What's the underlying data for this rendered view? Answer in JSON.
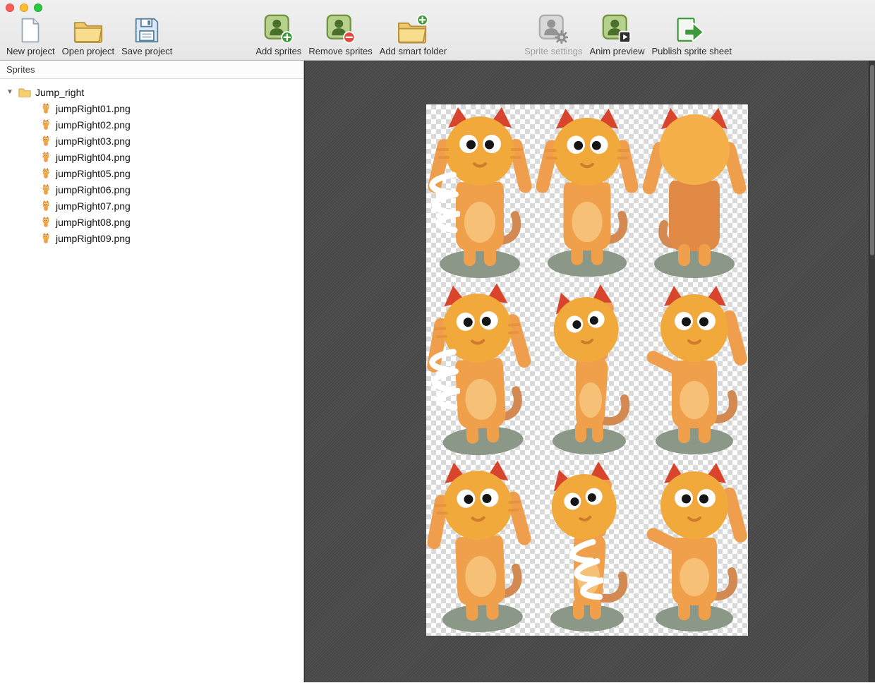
{
  "window": {
    "traffic_lights": {
      "close": "#ff5f57",
      "minimize": "#febc2e",
      "zoom": "#28c840"
    }
  },
  "toolbar": {
    "items": [
      {
        "label": "New project",
        "icon": "new-project-icon",
        "enabled": true
      },
      {
        "label": "Open project",
        "icon": "open-project-icon",
        "enabled": true
      },
      {
        "label": "Save project",
        "icon": "save-project-icon",
        "enabled": true
      },
      {
        "label": "Add sprites",
        "icon": "add-sprites-icon",
        "enabled": true
      },
      {
        "label": "Remove sprites",
        "icon": "remove-sprites-icon",
        "enabled": true
      },
      {
        "label": "Add smart folder",
        "icon": "add-smart-folder-icon",
        "enabled": true
      },
      {
        "label": "Sprite settings",
        "icon": "sprite-settings-icon",
        "enabled": false
      },
      {
        "label": "Anim preview",
        "icon": "anim-preview-icon",
        "enabled": true
      },
      {
        "label": "Publish sprite sheet",
        "icon": "publish-sprite-sheet-icon",
        "enabled": true
      }
    ]
  },
  "sidebar": {
    "header": "Sprites",
    "folder": {
      "name": "Jump_right",
      "expanded": true,
      "disclosure": "▼"
    },
    "files": [
      "jumpRight01.png",
      "jumpRight02.png",
      "jumpRight03.png",
      "jumpRight04.png",
      "jumpRight05.png",
      "jumpRight06.png",
      "jumpRight07.png",
      "jumpRight08.png",
      "jumpRight09.png"
    ]
  },
  "canvas": {
    "sheet": {
      "rows": 3,
      "cols": 3,
      "content": "9 cat jump-right animation frames on transparency checkerboard"
    }
  },
  "colors": {
    "toolbar_bg": "#ebebeb",
    "canvas_bg": "#4e4e4e",
    "cat_orange": "#f2a93b",
    "cat_arm": "#ef9e4e",
    "cat_belly": "#f6c177",
    "ear_red": "#d9452c",
    "tail_brown": "#d28a52",
    "shadow_green": "#8b9787",
    "sprite_icon_green": "#b7d18d",
    "folder_yellow": "#eec96a"
  }
}
